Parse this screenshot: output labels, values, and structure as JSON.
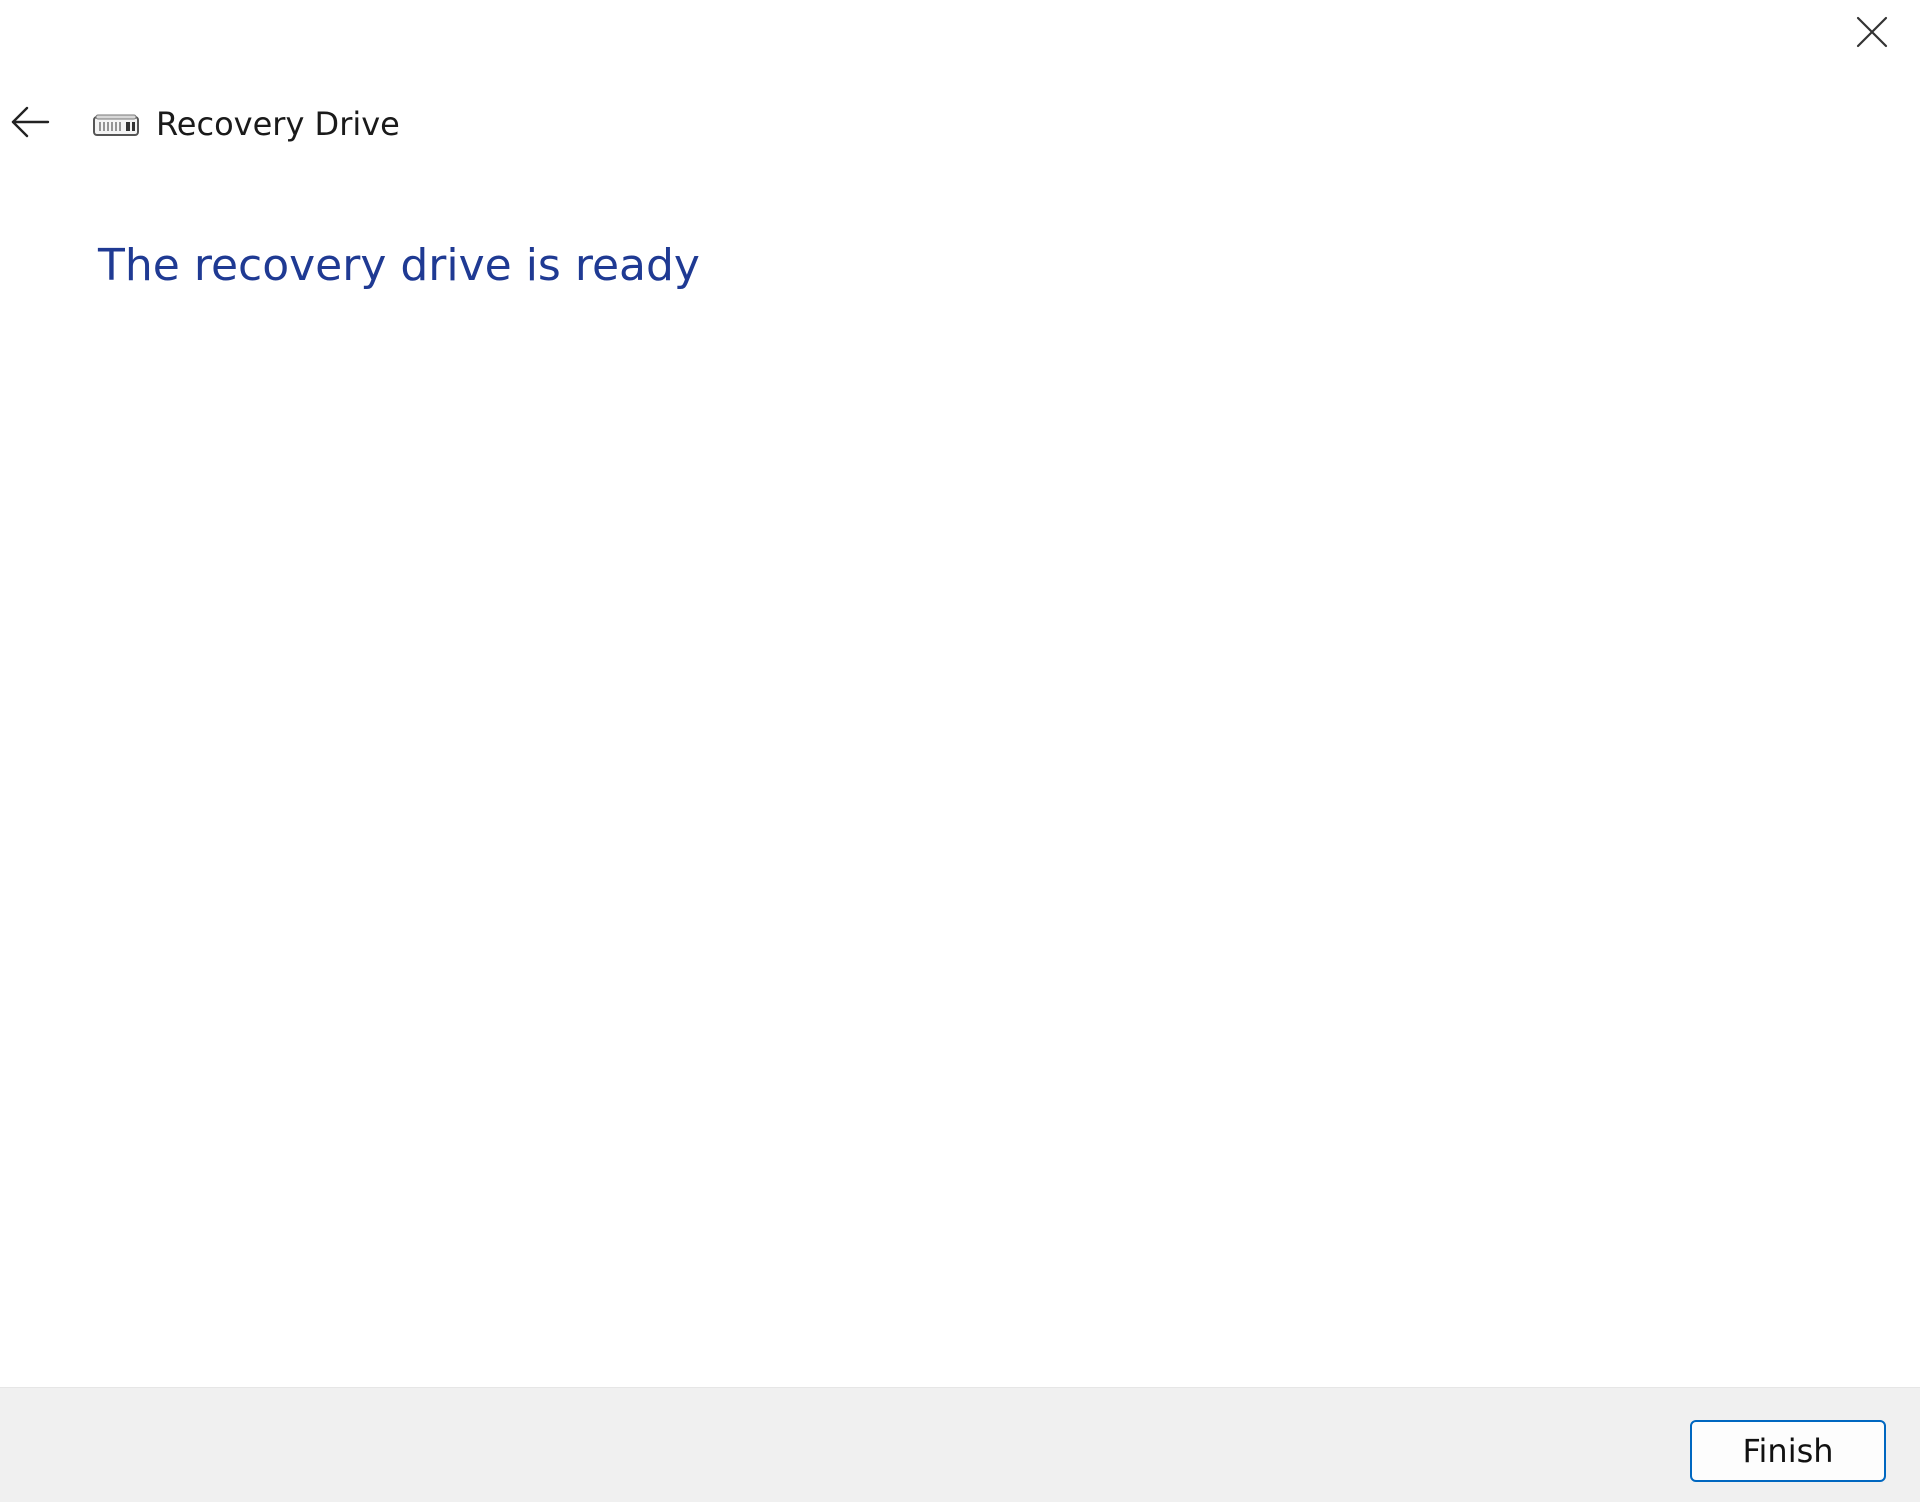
{
  "window": {
    "title": "Recovery Drive",
    "icon": "usb-drive-icon",
    "close_icon": "close-icon",
    "back_icon": "arrow-left-icon"
  },
  "main": {
    "heading": "The recovery drive is ready"
  },
  "footer": {
    "finish_label": "Finish"
  },
  "colors": {
    "heading": "#1f3a93",
    "button_border": "#0067c0",
    "footer_bg": "#f0f0f0",
    "background": "#ffffff"
  }
}
